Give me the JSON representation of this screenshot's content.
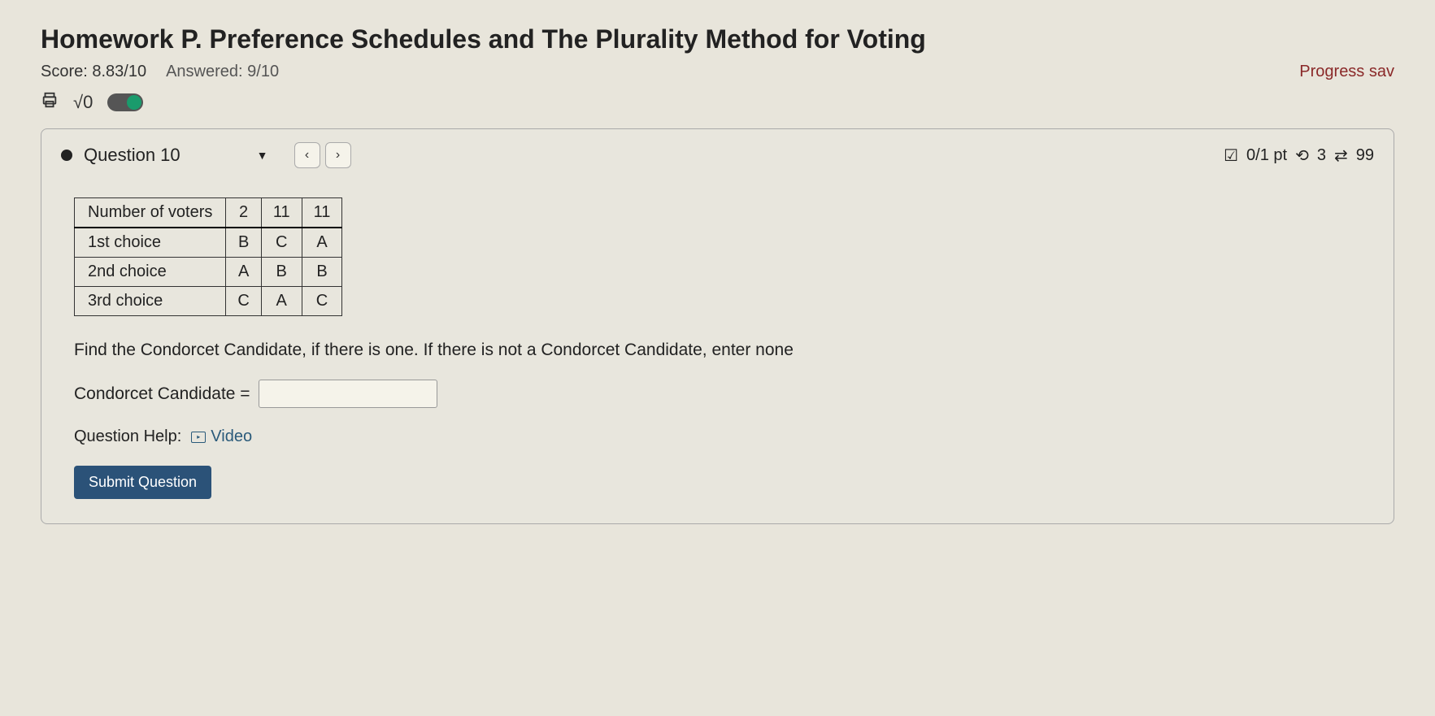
{
  "header": {
    "title": "Homework P. Preference Schedules and The Plurality Method for Voting",
    "score_label": "Score: 8.83/10",
    "answered_label": "Answered: 9/10",
    "progress_saved": "Progress sav"
  },
  "question_nav": {
    "current_label": "Question 10",
    "prev": "‹",
    "next": "›",
    "points_label": "0/1 pt",
    "attempts": "3",
    "tries": "99"
  },
  "table": {
    "header_label": "Number of voters",
    "columns": [
      "2",
      "11",
      "11"
    ],
    "rows": [
      {
        "label": "1st choice",
        "cells": [
          "B",
          "C",
          "A"
        ]
      },
      {
        "label": "2nd choice",
        "cells": [
          "A",
          "B",
          "B"
        ]
      },
      {
        "label": "3rd choice",
        "cells": [
          "C",
          "A",
          "C"
        ]
      }
    ]
  },
  "prompt": "Find the Condorcet Candidate, if there is one. If there is not a Condorcet Candidate, enter none",
  "answer": {
    "label": "Condorcet Candidate =",
    "value": "",
    "placeholder": ""
  },
  "help": {
    "label": "Question Help:",
    "video_label": "Video"
  },
  "submit_label": "Submit Question"
}
